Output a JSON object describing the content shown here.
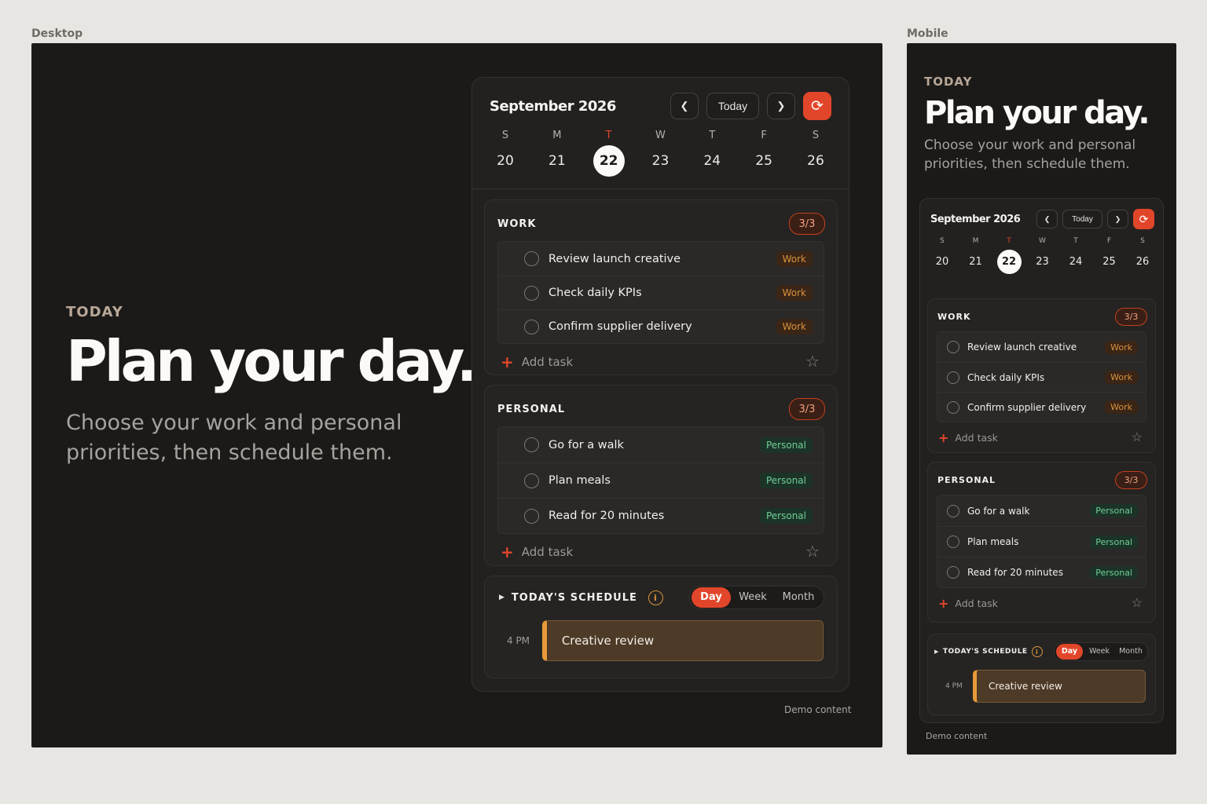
{
  "frames": {
    "desktop": "Desktop",
    "mobile": "Mobile"
  },
  "hero": {
    "eyebrow": "TODAY",
    "headline": "Plan your day.",
    "subtitle_line1": "Choose your work and personal",
    "subtitle_line2": "priorities, then schedule them."
  },
  "calendar": {
    "month": "September 2026",
    "prev_icon": "chevron-left-icon",
    "next_icon": "chevron-right-icon",
    "today_label": "Today",
    "refresh_icon": "refresh-icon",
    "days": [
      {
        "dow": "S",
        "num": "20"
      },
      {
        "dow": "M",
        "num": "21"
      },
      {
        "dow": "T",
        "num": "22",
        "selected": true
      },
      {
        "dow": "W",
        "num": "23"
      },
      {
        "dow": "T",
        "num": "24"
      },
      {
        "dow": "F",
        "num": "25"
      },
      {
        "dow": "S",
        "num": "26"
      }
    ]
  },
  "work": {
    "title": "WORK",
    "count": "3/3",
    "tasks": [
      {
        "label": "Review launch creative",
        "tag": "Work"
      },
      {
        "label": "Check daily KPIs",
        "tag": "Work"
      },
      {
        "label": "Confirm supplier delivery",
        "tag": "Work"
      }
    ],
    "add_label": "Add task"
  },
  "personal": {
    "title": "PERSONAL",
    "count": "3/3",
    "tasks": [
      {
        "label": "Go for a walk",
        "tag": "Personal"
      },
      {
        "label": "Plan meals",
        "tag": "Personal"
      },
      {
        "label": "Read for 20 minutes",
        "tag": "Personal"
      }
    ],
    "add_label": "Add task"
  },
  "schedule": {
    "title": "TODAY'S SCHEDULE",
    "info_icon": "info-icon",
    "views": [
      "Day",
      "Week",
      "Month"
    ],
    "active_view": "Day",
    "events": [
      {
        "time": "4 PM",
        "title": "Creative review"
      }
    ]
  },
  "footer": {
    "demo": "Demo content"
  },
  "colors": {
    "accent": "#e2462a",
    "background": "#1b1a19",
    "work_tag": "#d9923d",
    "personal_tag": "#6fcf97",
    "event": "#e89a3a"
  }
}
